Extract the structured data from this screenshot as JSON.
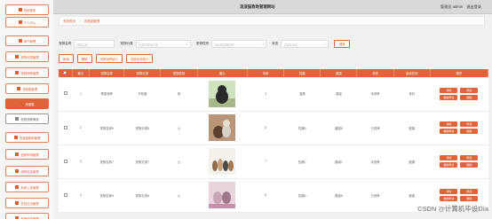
{
  "topbar": {
    "title": "流浪猫救助管理网站",
    "user_label": "管理员 admin",
    "logout_label": "退出登录"
  },
  "sidebar": {
    "items": [
      {
        "label": "系统首页",
        "state": "normal"
      },
      {
        "label": "个人中心",
        "state": "normal"
      },
      {
        "label": "用户管理",
        "state": "normal"
      },
      {
        "label": "宠物分类管理",
        "state": "normal"
      },
      {
        "label": "宠物领养管理",
        "state": "normal"
      },
      {
        "label": "流浪猫管理",
        "state": "normal"
      },
      {
        "label": "流浪猫",
        "state": "active"
      },
      {
        "label": "宠物领养审核",
        "state": "sub"
      },
      {
        "label": "流浪猫救助管理",
        "state": "normal"
      },
      {
        "label": "送养申请管理",
        "state": "normal"
      },
      {
        "label": "领养信息管理",
        "state": "normal"
      },
      {
        "label": "系统公告管理",
        "state": "normal"
      },
      {
        "label": "在线交流管理",
        "state": "normal"
      },
      {
        "label": "系统信息管理",
        "state": "normal"
      }
    ]
  },
  "breadcrumb": {
    "home": "系统首页",
    "sep": "/",
    "current": "流浪猫管理"
  },
  "filters": {
    "name_label": "宠物名称",
    "name_placeholder": "宠物名称",
    "category_label": "宠物分类",
    "category_placeholder": "请选择宠物分类",
    "gender_label": "宠物性别",
    "gender_placeholder": "请选择宠物性别",
    "status_label": "状态",
    "status_placeholder": "请选择状态",
    "search_button": "搜索"
  },
  "actions": {
    "add": "新增",
    "delete": "删除",
    "stat1": "宠物领养统计",
    "stat2": "流浪状态统计"
  },
  "table": {
    "headers": [
      "",
      "索引",
      "宠物名称",
      "宠物分类",
      "宠物性别",
      "图片",
      "年龄",
      "性格",
      "健康",
      "状态",
      "身体状况",
      "操作"
    ],
    "rows": [
      {
        "index": "1",
        "name": "黑猫领养",
        "category": "不知道",
        "gender": "母",
        "age": "3",
        "character": "温顺",
        "health": "健康",
        "status": "未领养",
        "body": "良好",
        "img": "cat1"
      },
      {
        "index": "2",
        "name": "宠物名称6",
        "category": "宠物分类6",
        "gender": "公",
        "age": "6",
        "character": "性格6",
        "health": "健康6",
        "status": "已领养",
        "body": "健康",
        "img": "cat2"
      },
      {
        "index": "3",
        "name": "宠物名称7",
        "category": "宠物分类7",
        "gender": "公",
        "age": "7",
        "character": "性格7",
        "health": "健康7",
        "status": "未领养",
        "body": "健康",
        "img": "cat3"
      },
      {
        "index": "4",
        "name": "宠物名称8",
        "category": "宠物分类8",
        "gender": "公",
        "age": "8",
        "character": "性格8",
        "health": "健康8",
        "status": "已领养",
        "body": "健康",
        "img": "cat4"
      }
    ],
    "op_detail": "详情",
    "op_edit": "修改",
    "op_apply": "救助申请",
    "op_delete": "删除"
  },
  "watermark": "CSDN @计算机毕设Dia",
  "colors": {
    "accent": "#e0643a",
    "sidebar_bg": "#f6f6f6",
    "topbar_bg": "#d9d9d9"
  }
}
